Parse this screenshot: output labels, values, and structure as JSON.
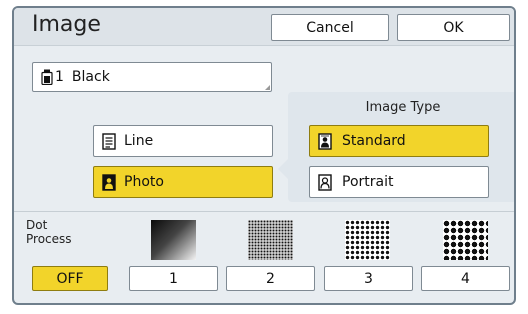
{
  "dialog": {
    "title": "Image",
    "cancel_label": "Cancel",
    "ok_label": "OK"
  },
  "ink": {
    "number": "1",
    "color_name": "Black"
  },
  "mode": {
    "line_label": "Line",
    "photo_label": "Photo",
    "selected": "Photo"
  },
  "image_type": {
    "heading": "Image Type",
    "standard_label": "Standard",
    "portrait_label": "Portrait",
    "selected": "Standard"
  },
  "dot_process": {
    "label_line1": "Dot",
    "label_line2": "Process",
    "options": [
      "OFF",
      "1",
      "2",
      "3",
      "4"
    ],
    "selected": "OFF"
  },
  "colors": {
    "selected": "#f2d42a",
    "frame": "#6f7f8c"
  }
}
